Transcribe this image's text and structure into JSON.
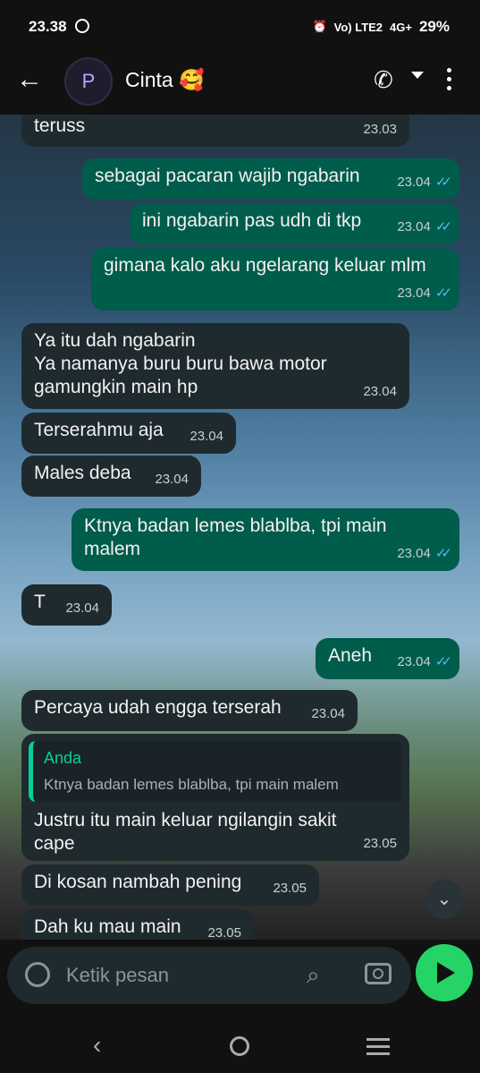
{
  "status_bar": {
    "time": "23.38",
    "signal_1": "Vo) LTE2",
    "signal_2": "4G+",
    "battery": "29%"
  },
  "header": {
    "avatar_letter": "P",
    "contact_name": "Cinta 🥰"
  },
  "messages": [
    {
      "dir": "in",
      "text": "teruss",
      "time": "23.03"
    },
    {
      "dir": "out",
      "text": "sebagai pacaran wajib ngabarin",
      "time": "23.04"
    },
    {
      "dir": "out",
      "text": "ini ngabarin pas udh di tkp",
      "time": "23.04"
    },
    {
      "dir": "out",
      "text": "gimana kalo aku ngelarang keluar mlm",
      "time": "23.04"
    },
    {
      "dir": "in",
      "text": "Ya itu dah ngabarin\nYa namanya buru buru bawa motor\ngamungkin main hp",
      "time": "23.04"
    },
    {
      "dir": "in",
      "text": "Terserahmu aja",
      "time": "23.04"
    },
    {
      "dir": "in",
      "text": "Males deba",
      "time": "23.04"
    },
    {
      "dir": "out",
      "text": "Ktnya badan lemes blablba, tpi main\nmalem",
      "time": "23.04"
    },
    {
      "dir": "in",
      "text": "T",
      "time": "23.04"
    },
    {
      "dir": "out",
      "text": "Aneh",
      "time": "23.04"
    },
    {
      "dir": "in",
      "text": "Percaya udah engga terserah",
      "time": "23.04"
    },
    {
      "dir": "in",
      "text": "Justru itu main keluar ngilangin sakit\ncape",
      "time": "23.05",
      "quote_name": "Anda",
      "quote_text": "Ktnya badan lemes blablba, tpi main malem"
    },
    {
      "dir": "in",
      "text": "Di kosan nambah pening",
      "time": "23.05"
    },
    {
      "dir": "in",
      "text": "Dah ku mau main",
      "time": "23.05"
    }
  ],
  "composer": {
    "placeholder": "Ketik pesan"
  },
  "icons": {
    "back": "arrow-left-icon",
    "phone": "phone-icon",
    "menu": "more-vertical-icon",
    "emoji": "sticker-icon",
    "attach": "paperclip-icon",
    "camera": "camera-icon",
    "send": "send-icon",
    "scroll_down": "chevron-double-down-icon"
  },
  "colors": {
    "outgoing_bubble": "#005c4b",
    "incoming_bubble": "#1f2a2e",
    "send_button": "#25d366",
    "read_ticks": "#53bdeb"
  }
}
